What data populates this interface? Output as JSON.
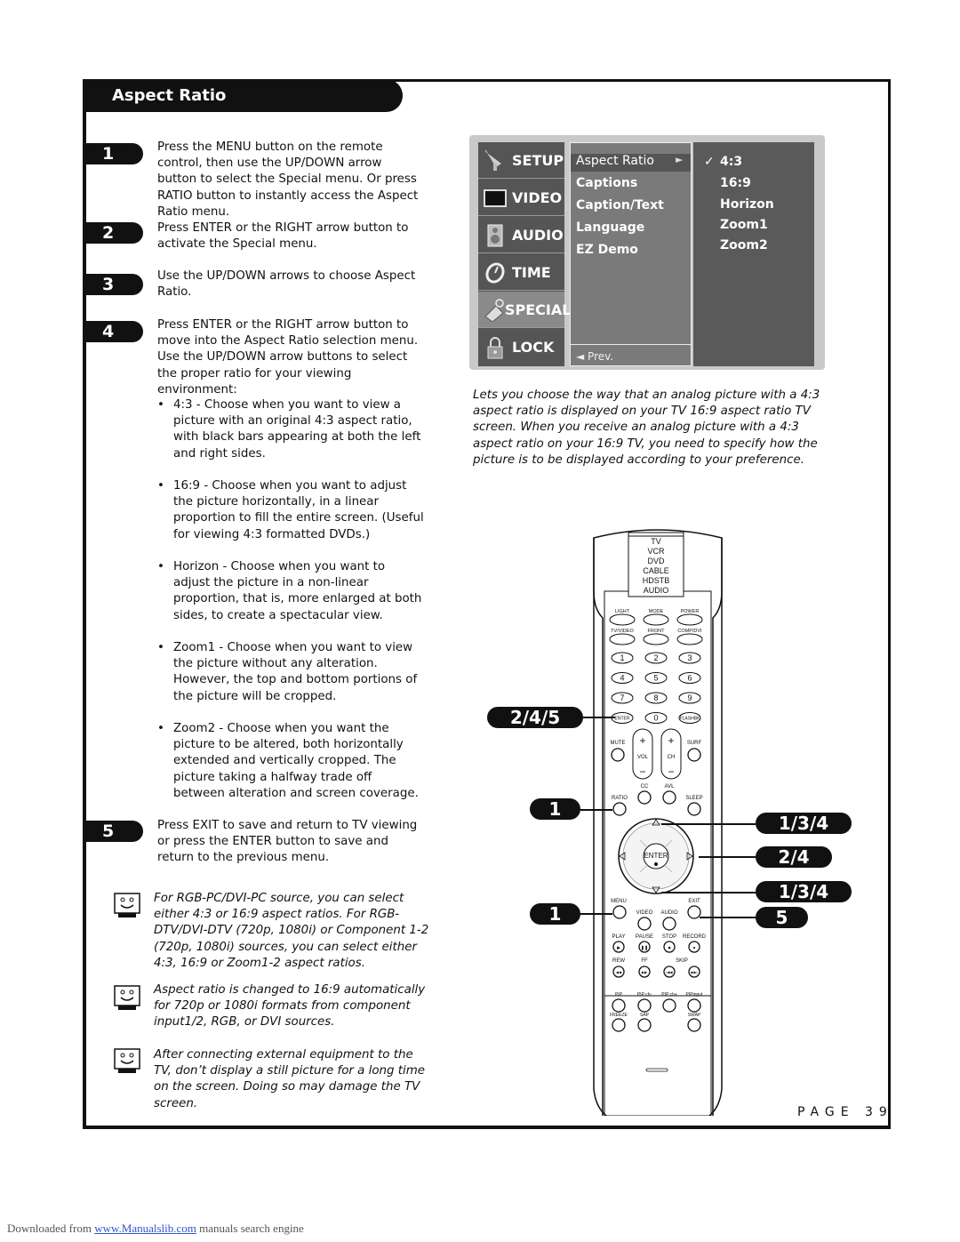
{
  "section": {
    "title": "Aspect Ratio"
  },
  "steps": [
    {
      "num": "1",
      "text": "Press the MENU button on the remote control, then use the UP/DOWN arrow button to select the Special menu. Or press RATIO button to instantly access the Aspect Ratio menu."
    },
    {
      "num": "2",
      "text": "Press ENTER or the RIGHT arrow button to activate the Special menu."
    },
    {
      "num": "3",
      "text": "Use the UP/DOWN arrows to choose Aspect Ratio."
    },
    {
      "num": "4",
      "text": "Press ENTER or the RIGHT arrow button to move into the Aspect Ratio selection menu. Use the UP/DOWN arrow buttons to select the proper ratio for your viewing environment:"
    },
    {
      "num": "5",
      "text": "Press EXIT to save and return to TV viewing or press the ENTER button to save and return to the previous menu."
    }
  ],
  "bullets": [
    "4:3 - Choose when you want to view a picture with an original 4:3 aspect ratio, with black bars appearing at both the left and right sides.",
    "16:9 - Choose when you want to adjust the picture horizontally, in a linear proportion to fill the entire screen. (Useful for viewing 4:3 formatted DVDs.)",
    "Horizon - Choose when you want to adjust the picture in a non-linear proportion, that is, more enlarged at both sides, to create a spectacular view.",
    "Zoom1 - Choose when you want to view the picture without any alteration. However, the top and bottom portions of the picture will be cropped.",
    "Zoom2 - Choose when you want the picture to be altered, both horizontally extended and vertically cropped. The picture taking a halfway trade off between alteration and screen coverage."
  ],
  "notes": [
    "For RGB-PC/DVI-PC source, you can select either 4:3 or 16:9 aspect ratios. For RGB-DTV/DVI-DTV (720p, 1080i) or Component 1-2 (720p, 1080i) sources, you can select either 4:3, 16:9 or Zoom1-2 aspect ratios.",
    "Aspect ratio is changed to 16:9 automatically for 720p or 1080i formats from component input1/2, RGB, or DVI sources.",
    "After connecting external equipment to the TV, don’t display a still picture for a long time on the screen. Doing so may damage the TV screen."
  ],
  "osd": {
    "categories": [
      {
        "label": "SETUP",
        "icon": "satellite-icon"
      },
      {
        "label": "VIDEO",
        "icon": "screen-icon"
      },
      {
        "label": "AUDIO",
        "icon": "speaker-icon"
      },
      {
        "label": "TIME",
        "icon": "clock-icon"
      },
      {
        "label": "SPECIAL",
        "icon": "tag-icon"
      },
      {
        "label": "LOCK",
        "icon": "lock-icon"
      }
    ],
    "selected_category": "SPECIAL",
    "items": [
      "Aspect Ratio",
      "Captions",
      "Caption/Text",
      "Language",
      "EZ Demo"
    ],
    "selected_item": "Aspect Ratio",
    "submenu_arrow": "►",
    "prev": "◄ Prev.",
    "options": [
      "4:3",
      "16:9",
      "Horizon",
      "Zoom1",
      "Zoom2"
    ],
    "checked_option": "4:3",
    "check_mark": "✓"
  },
  "caption": "Lets you choose the way that an analog picture with a 4:3 aspect ratio is displayed on your TV 16:9 aspect ratio TV screen. When you receive an analog picture with a 4:3 aspect ratio on your 16:9 TV, you need to specify how the picture is to be displayed according to your preference.",
  "remote": {
    "modes": [
      "TV",
      "VCR",
      "DVD",
      "CABLE",
      "HDSTB",
      "AUDIO"
    ],
    "top_buttons": [
      "LIGHT",
      "MODE",
      "POWER",
      "TV/VIDEO",
      "FRONT",
      "COMP/DVI"
    ],
    "number_keys": [
      "1",
      "2",
      "3",
      "4",
      "5",
      "6",
      "7",
      "8",
      "9",
      "ENTER",
      "0",
      "FLASHBK"
    ],
    "mute": "MUTE",
    "vol": "VOL",
    "ch": "CH",
    "surf": "SURF",
    "row_ratio": [
      "RATIO",
      "CC",
      "AVL",
      "SLEEP"
    ],
    "enter": "ENTER",
    "menu": "MENU",
    "exit": "EXIT",
    "video": "VIDEO",
    "audio": "AUDIO",
    "transport": [
      "PLAY",
      "PAUSE",
      "STOP",
      "RECORD"
    ],
    "transport2": [
      "REW",
      "FF",
      "SKIP"
    ],
    "pip": [
      "PIP",
      "PIP ch-",
      "PIP ch+",
      "PIPinput"
    ],
    "pip2": [
      "FREEZE",
      "SAP",
      "SWAP"
    ]
  },
  "callouts": [
    {
      "label": "2/4/5",
      "target": "ENTER key"
    },
    {
      "label": "1",
      "target": "RATIO"
    },
    {
      "label": "1",
      "target": "MENU"
    },
    {
      "label": "1/3/4",
      "target": "UP arrow"
    },
    {
      "label": "2/4",
      "target": "RIGHT arrow"
    },
    {
      "label": "1/3/4",
      "target": "DOWN arrow"
    },
    {
      "label": "5",
      "target": "EXIT"
    }
  ],
  "page": "PAGE 39",
  "footer": {
    "prefix": "Downloaded from",
    "link": "www.Manualslib.com",
    "suffix": "manuals search engine"
  }
}
